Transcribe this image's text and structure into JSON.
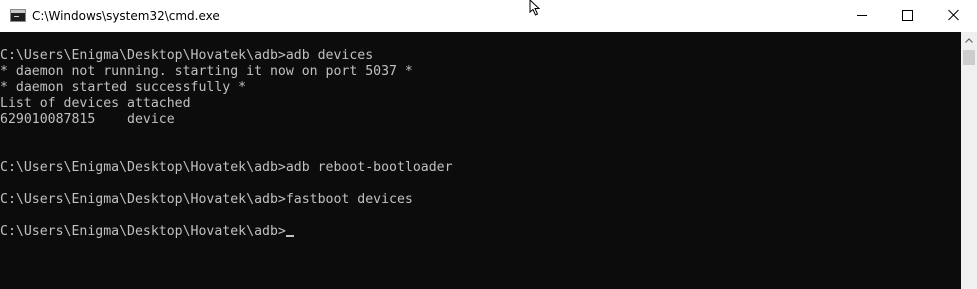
{
  "window": {
    "title": "C:\\Windows\\system32\\cmd.exe",
    "icon": "cmd-console-icon"
  },
  "caption_buttons": {
    "minimize_icon": "minimize-icon",
    "maximize_icon": "maximize-icon",
    "close_icon": "close-icon"
  },
  "console": {
    "background": "#0c0c0c",
    "foreground": "#c0c0c0",
    "lines": [
      "C:\\Users\\Enigma\\Desktop\\Hovatek\\adb>adb devices",
      "* daemon not running. starting it now on port 5037 *",
      "* daemon started successfully *",
      "List of devices attached",
      "629010087815    device",
      "",
      "",
      "C:\\Users\\Enigma\\Desktop\\Hovatek\\adb>adb reboot-bootloader",
      "",
      "C:\\Users\\Enigma\\Desktop\\Hovatek\\adb>fastboot devices",
      "",
      "C:\\Users\\Enigma\\Desktop\\Hovatek\\adb>"
    ]
  },
  "scrollbar": {
    "up_icon": "scroll-up-arrow-icon"
  }
}
